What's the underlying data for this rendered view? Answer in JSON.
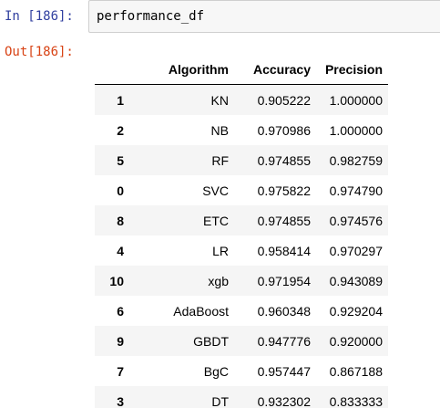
{
  "cell": {
    "in_prompt": "In [186]:",
    "code": "performance_df",
    "out_prompt": "Out[186]:"
  },
  "table": {
    "columns": [
      "Algorithm",
      "Accuracy",
      "Precision"
    ],
    "rows": [
      {
        "index": "1",
        "algorithm": "KN",
        "accuracy": "0.905222",
        "precision": "1.000000"
      },
      {
        "index": "2",
        "algorithm": "NB",
        "accuracy": "0.970986",
        "precision": "1.000000"
      },
      {
        "index": "5",
        "algorithm": "RF",
        "accuracy": "0.974855",
        "precision": "0.982759"
      },
      {
        "index": "0",
        "algorithm": "SVC",
        "accuracy": "0.975822",
        "precision": "0.974790"
      },
      {
        "index": "8",
        "algorithm": "ETC",
        "accuracy": "0.974855",
        "precision": "0.974576"
      },
      {
        "index": "4",
        "algorithm": "LR",
        "accuracy": "0.958414",
        "precision": "0.970297"
      },
      {
        "index": "10",
        "algorithm": "xgb",
        "accuracy": "0.971954",
        "precision": "0.943089"
      },
      {
        "index": "6",
        "algorithm": "AdaBoost",
        "accuracy": "0.960348",
        "precision": "0.929204"
      },
      {
        "index": "9",
        "algorithm": "GBDT",
        "accuracy": "0.947776",
        "precision": "0.920000"
      },
      {
        "index": "7",
        "algorithm": "BgC",
        "accuracy": "0.957447",
        "precision": "0.867188"
      },
      {
        "index": "3",
        "algorithm": "DT",
        "accuracy": "0.932302",
        "precision": "0.833333"
      }
    ]
  },
  "colors": {
    "in_prompt": "#303f9f",
    "out_prompt": "#d84315",
    "input_bg": "#f7f7f7",
    "stripe": "#f5f5f5"
  }
}
